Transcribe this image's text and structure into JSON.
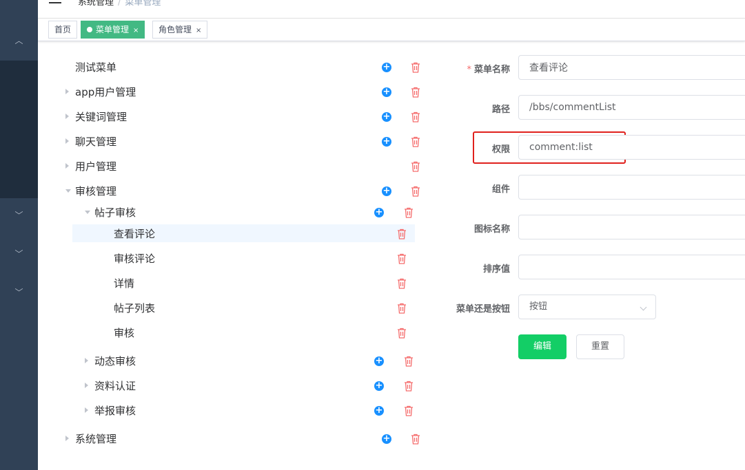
{
  "header": {
    "breadcrumb": [
      "系统管理",
      "菜单管理"
    ]
  },
  "tags": [
    {
      "label": "首页",
      "active": false,
      "closable": false
    },
    {
      "label": "菜单管理",
      "active": true,
      "closable": true
    },
    {
      "label": "角色管理",
      "active": false,
      "closable": true
    }
  ],
  "tree": [
    {
      "label": "测试菜单",
      "expandable": false,
      "expanded": false,
      "level": 0,
      "add": true,
      "delete": true
    },
    {
      "label": "app用户管理",
      "expandable": true,
      "expanded": false,
      "level": 0,
      "add": true,
      "delete": true
    },
    {
      "label": "关键词管理",
      "expandable": true,
      "expanded": false,
      "level": 0,
      "add": true,
      "delete": true
    },
    {
      "label": "聊天管理",
      "expandable": true,
      "expanded": false,
      "level": 0,
      "add": true,
      "delete": true
    },
    {
      "label": "用户管理",
      "expandable": true,
      "expanded": false,
      "level": 0,
      "add": false,
      "delete": true
    },
    {
      "label": "审核管理",
      "expandable": true,
      "expanded": true,
      "level": 0,
      "add": true,
      "delete": true
    },
    {
      "label": "帖子审核",
      "expandable": true,
      "expanded": true,
      "level": 1,
      "add": true,
      "delete": true
    },
    {
      "label": "查看评论",
      "expandable": false,
      "expanded": false,
      "level": 2,
      "add": false,
      "delete": true,
      "selected": true
    },
    {
      "label": "审核评论",
      "expandable": false,
      "expanded": false,
      "level": 2,
      "add": false,
      "delete": true
    },
    {
      "label": "详情",
      "expandable": false,
      "expanded": false,
      "level": 2,
      "add": false,
      "delete": true
    },
    {
      "label": "帖子列表",
      "expandable": false,
      "expanded": false,
      "level": 2,
      "add": false,
      "delete": true
    },
    {
      "label": "审核",
      "expandable": false,
      "expanded": false,
      "level": 2,
      "add": false,
      "delete": true
    },
    {
      "label": "动态审核",
      "expandable": true,
      "expanded": false,
      "level": 1,
      "add": true,
      "delete": true
    },
    {
      "label": "资料认证",
      "expandable": true,
      "expanded": false,
      "level": 1,
      "add": true,
      "delete": true
    },
    {
      "label": "举报审核",
      "expandable": true,
      "expanded": false,
      "level": 1,
      "add": true,
      "delete": true
    },
    {
      "label": "系统管理",
      "expandable": true,
      "expanded": false,
      "level": 0,
      "add": true,
      "delete": true
    }
  ],
  "form": {
    "name_label": "菜单名称",
    "name_value": "查看评论",
    "path_label": "路径",
    "path_value": "/bbs/commentList",
    "perm_label": "权限",
    "perm_value": "comment:list",
    "component_label": "组件",
    "component_value": "",
    "icon_label": "图标名称",
    "icon_value": "",
    "sort_label": "排序值",
    "sort_value": "",
    "type_label": "菜单还是按钮",
    "type_value": "按钮",
    "edit_button": "编辑",
    "reset_button": "重置"
  },
  "colors": {
    "sidebar": "#304156",
    "active_tag": "#42b983",
    "primary_button": "#13ce66",
    "add_icon": "#1890ff",
    "delete_icon": "#f56c6c",
    "highlight_box": "#e0201c"
  }
}
